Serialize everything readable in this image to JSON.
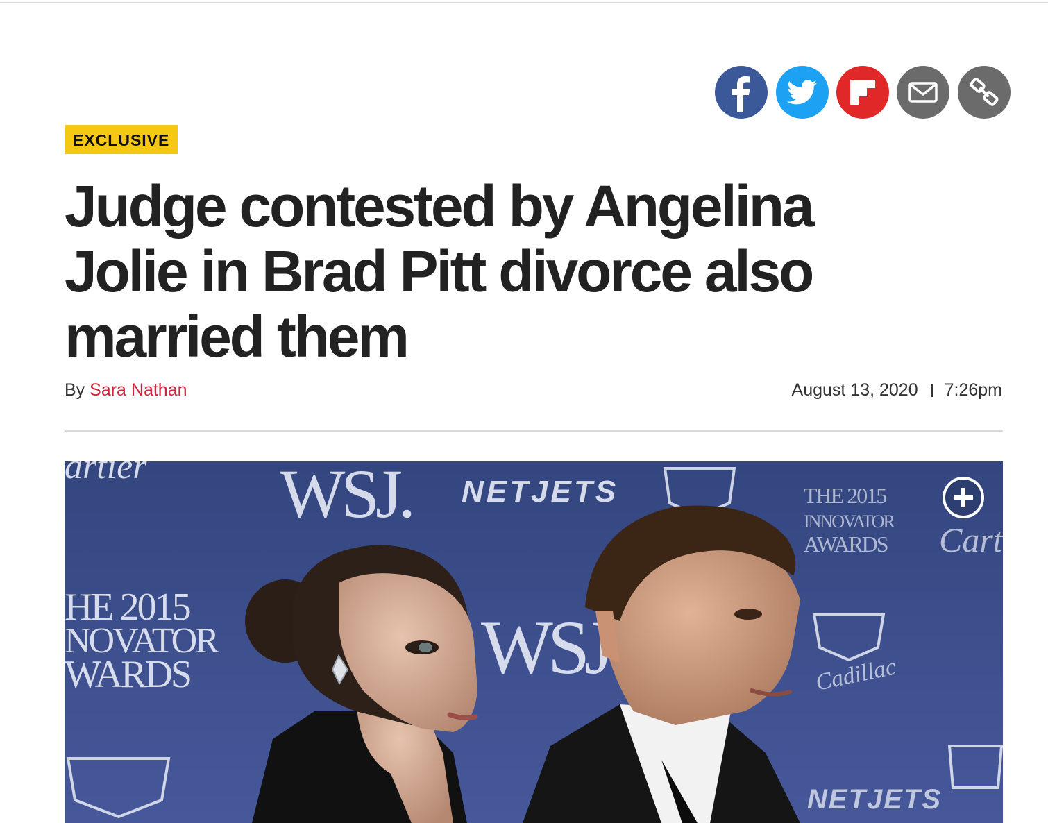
{
  "share": {
    "buttons": [
      {
        "name": "facebook",
        "icon": "facebook-icon",
        "color": "#3b5998"
      },
      {
        "name": "twitter",
        "icon": "twitter-icon",
        "color": "#1da1f2"
      },
      {
        "name": "flipboard",
        "icon": "flipboard-icon",
        "color": "#e12828"
      },
      {
        "name": "email",
        "icon": "mail-icon",
        "color": "#6b6b6b"
      },
      {
        "name": "copy-link",
        "icon": "link-icon",
        "color": "#6b6b6b"
      }
    ]
  },
  "article": {
    "badge": "EXCLUSIVE",
    "headline": "Judge contested by Angelina Jolie in Brad Pitt divorce also married them",
    "byline_prefix": "By",
    "author": "Sara Nathan",
    "date": "August 13, 2020",
    "time": "7:26pm"
  },
  "photo": {
    "backdrop_text": {
      "cartier_top": "artier",
      "wsj_top": "WSJ.",
      "netjets_top": "NETJETS",
      "awards_left": [
        "HE 2015",
        "NOVATOR",
        "WARDS"
      ],
      "wsj_middle": "WSJ.",
      "awards_right": [
        "THE 2015",
        "INNOVATOR",
        "AWARDS"
      ],
      "cartier_right": "Cartier",
      "cadillac_script": "Cadillac",
      "netjets_bottom": "NETJETS"
    },
    "expand_icon": "plus-icon"
  },
  "colors": {
    "badge_bg": "#f6c813",
    "author_link": "#d0243d",
    "photo_backdrop": "#3b4d86"
  }
}
